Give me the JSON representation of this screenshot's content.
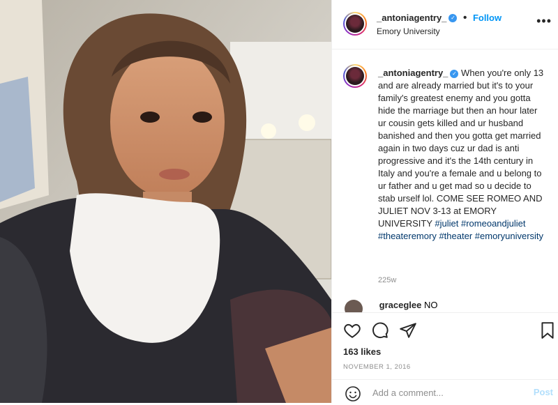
{
  "post": {
    "author": "_antoniagentry_",
    "follow_label": "Follow",
    "location": "Emory University",
    "caption": "When you're only 13 and are already married but it's to your family's greatest enemy and you gotta hide the marriage but then an hour later ur cousin gets killed and ur husband banished and then you gotta get married again in two days cuz ur dad is anti progressive and it's the 14th century in Italy and you're a female and u belong to ur father and u get mad so u decide to stab urself lol. COME SEE ROMEO AND JULIET NOV 3-13 at EMORY UNIVERSITY",
    "hashtags": [
      "#juliet",
      "#romeoandjuliet",
      "#theateremory",
      "#theater",
      "#emoryuniversity"
    ],
    "time_ago": "225w",
    "likes": "163 likes",
    "date": "NOVEMBER 1, 2016"
  },
  "comments": [
    {
      "username": "graceglee",
      "text": "NO"
    }
  ],
  "add_comment": {
    "placeholder": "Add a comment...",
    "post_label": "Post"
  },
  "icons": {
    "more": "more-options-icon",
    "like": "heart-icon",
    "comment": "comment-icon",
    "share": "send-icon",
    "save": "bookmark-icon",
    "emoji": "emoji-icon",
    "verified": "verified-badge-icon"
  },
  "colors": {
    "accent": "#0095f6",
    "verified": "#3897f0",
    "hashtag": "#00376b",
    "muted": "#8e8e8e"
  }
}
